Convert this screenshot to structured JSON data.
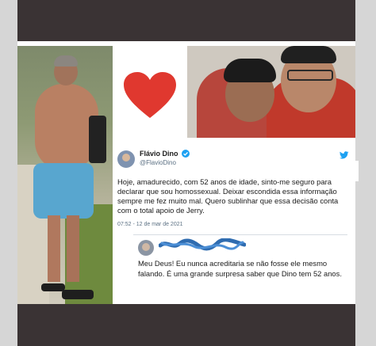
{
  "tweet": {
    "name": "Flávio Dino",
    "handle": "@FlavioDino",
    "text": "Hoje, amadurecido, com  52 anos de idade, sinto-me seguro para declarar que sou homossexual. Deixar escondida essa informação sempre me fez muito mal. Quero sublinhar que essa decisão conta com o total apoio de Jerry.",
    "timestamp": "07:52 - 12 de mar de 2021"
  },
  "reply": {
    "text": "Meu Deus! Eu nunca acreditaria se não fosse ele mesmo falando. É uma grande surpresa saber que Dino tem 52 anos."
  },
  "icons": {
    "heart": "heart-icon",
    "verified": "verified-badge-icon",
    "bird": "twitter-bird-icon"
  },
  "colors": {
    "heart": "#e0382f",
    "twitter_blue": "#1da1f2",
    "frame_dark": "#3a3334",
    "redaction_blue": "#2f6cb0"
  }
}
